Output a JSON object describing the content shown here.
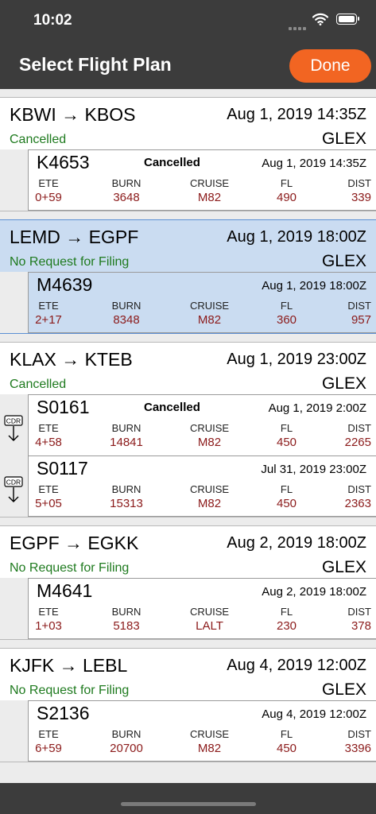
{
  "status_bar": {
    "time": "10:02"
  },
  "nav": {
    "title": "Select Flight Plan",
    "done_label": "Done"
  },
  "columns": {
    "ete": "ETE",
    "burn": "BURN",
    "cruise": "CRUISE",
    "fl": "FL",
    "dist": "DIST"
  },
  "cdr_label": "CDR",
  "groups": [
    {
      "route": "KBWI → KBOS",
      "date": "Aug 1, 2019 14:35Z",
      "status": "Cancelled",
      "aircraft": "GLEX",
      "selected": false,
      "plans": [
        {
          "id": "K4653",
          "status": "Cancelled",
          "date": "Aug 1, 2019 14:35Z",
          "ete": "0+59",
          "burn": "3648",
          "cruise": "M82",
          "fl": "490",
          "dist": "339",
          "cdr": false
        }
      ]
    },
    {
      "route": "LEMD → EGPF",
      "date": "Aug 1, 2019 18:00Z",
      "status": "No Request for Filing",
      "aircraft": "GLEX",
      "selected": true,
      "plans": [
        {
          "id": "M4639",
          "status": "",
          "date": "Aug 1, 2019 18:00Z",
          "ete": "2+17",
          "burn": "8348",
          "cruise": "M82",
          "fl": "360",
          "dist": "957",
          "cdr": false
        }
      ]
    },
    {
      "route": "KLAX → KTEB",
      "date": "Aug 1, 2019 23:00Z",
      "status": "Cancelled",
      "aircraft": "GLEX",
      "selected": false,
      "plans": [
        {
          "id": "S0161",
          "status": "Cancelled",
          "date": "Aug 1, 2019 2:00Z",
          "ete": "4+58",
          "burn": "14841",
          "cruise": "M82",
          "fl": "450",
          "dist": "2265",
          "cdr": true
        },
        {
          "id": "S0117",
          "status": "",
          "date": "Jul 31, 2019 23:00Z",
          "ete": "5+05",
          "burn": "15313",
          "cruise": "M82",
          "fl": "450",
          "dist": "2363",
          "cdr": true
        }
      ]
    },
    {
      "route": "EGPF → EGKK",
      "date": "Aug 2, 2019 18:00Z",
      "status": "No Request for Filing",
      "aircraft": "GLEX",
      "selected": false,
      "plans": [
        {
          "id": "M4641",
          "status": "",
          "date": "Aug 2, 2019 18:00Z",
          "ete": "1+03",
          "burn": "5183",
          "cruise": "LALT",
          "fl": "230",
          "dist": "378",
          "cdr": false
        }
      ]
    },
    {
      "route": "KJFK → LEBL",
      "date": "Aug 4, 2019 12:00Z",
      "status": "No Request for Filing",
      "aircraft": "GLEX",
      "selected": false,
      "plans": [
        {
          "id": "S2136",
          "status": "",
          "date": "Aug 4, 2019 12:00Z",
          "ete": "6+59",
          "burn": "20700",
          "cruise": "M82",
          "fl": "450",
          "dist": "3396",
          "cdr": false
        }
      ]
    }
  ]
}
